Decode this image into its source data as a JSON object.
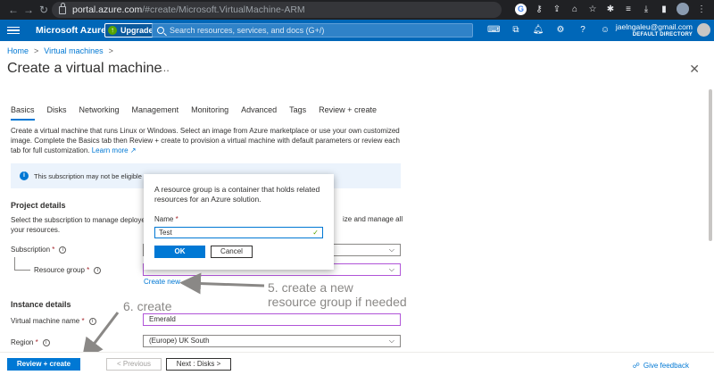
{
  "browser": {
    "nav": [
      "←",
      "→",
      "↻"
    ],
    "url_host": "portal.azure.com",
    "url_path": "/#create/Microsoft.VirtualMachine-ARM",
    "icons": [
      "google-icon",
      "key-icon",
      "share-icon",
      "bookmark-icon",
      "star-icon",
      "extensions-icon",
      "playlist-icon",
      "download-icon",
      "sidepanel-icon",
      "profile-avatar",
      "menu-kebab-icon"
    ]
  },
  "azure_header": {
    "brand": "Microsoft Azure",
    "upgrade_label": "Upgrade",
    "search_placeholder": "Search resources, services, and docs (G+/)",
    "icons": [
      "cloud-shell-icon",
      "directory-filter-icon",
      "bell-icon",
      "gear-icon",
      "help-icon",
      "feedback-person-icon"
    ],
    "user_email": "jaelngaleu@gmail.com",
    "user_directory": "DEFAULT DIRECTORY"
  },
  "breadcrumb": {
    "home": "Home",
    "sep": ">",
    "vms": "Virtual machines"
  },
  "page": {
    "title": "Create a virtual machine",
    "more": "...",
    "close": "✕"
  },
  "tabs": [
    "Basics",
    "Disks",
    "Networking",
    "Management",
    "Monitoring",
    "Advanced",
    "Tags",
    "Review + create"
  ],
  "active_tab": "Basics",
  "description": {
    "text": "Create a virtual machine that runs Linux or Windows. Select an image from Azure marketplace or use your own customized image. Complete the Basics tab then Review + create to provision a virtual machine with default parameters or review each tab for full customization.",
    "learn_more": "Learn more"
  },
  "info_bar": {
    "text": "This subscription may not be eligible to"
  },
  "project_details": {
    "heading": "Project details",
    "text_left": "Select the subscription to manage deployed",
    "text_left2": "your resources.",
    "text_right": "ize and manage all",
    "subscription_label": "Subscription",
    "resource_group_label": "Resource group",
    "resource_group_value": "",
    "create_new": "Create new"
  },
  "instance_details": {
    "heading": "Instance details",
    "vm_name_label": "Virtual machine name",
    "vm_name_value": "Emerald",
    "region_label": "Region",
    "region_value": "(Europe) UK South"
  },
  "popup": {
    "text": "A resource group is a container that holds related resources for an Azure solution.",
    "name_label": "Name",
    "name_value": "Test",
    "ok": "OK",
    "cancel": "Cancel"
  },
  "annotations": {
    "step5_line1": "5. create a new",
    "step5_line2": "resource group if needed",
    "step6": "6. create"
  },
  "footer": {
    "review_create": "Review + create",
    "previous": "< Previous",
    "next": "Next : Disks >",
    "feedback": "Give feedback"
  },
  "colors": {
    "azure_blue": "#0067b8",
    "accent": "#0078d4",
    "chrome_dark": "#202124",
    "annotation_gray": "#8a8886"
  }
}
